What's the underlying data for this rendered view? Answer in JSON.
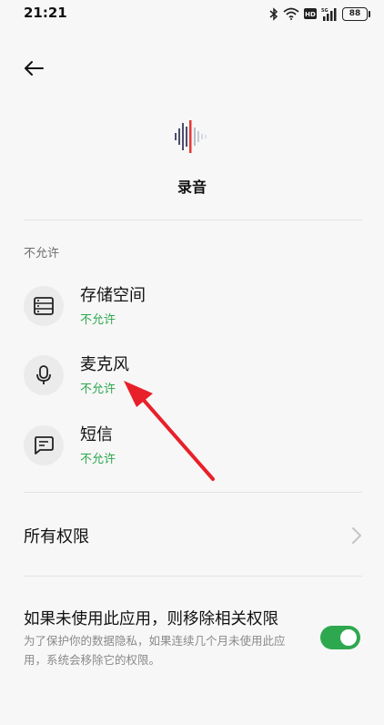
{
  "status_bar": {
    "time": "21:21",
    "battery_level": "88",
    "icons": [
      "bluetooth-icon",
      "wifi-icon",
      "hd-icon",
      "cellular-5g-icon",
      "battery-icon"
    ]
  },
  "header": {
    "back_icon": "back-arrow-icon"
  },
  "app": {
    "name": "录音",
    "icon": "voice-waveform-icon"
  },
  "section": {
    "title": "不允许"
  },
  "permissions": [
    {
      "label": "存储空间",
      "status": "不允许",
      "icon": "storage-icon"
    },
    {
      "label": "麦克风",
      "status": "不允许",
      "icon": "microphone-icon"
    },
    {
      "label": "短信",
      "status": "不允许",
      "icon": "message-icon"
    }
  ],
  "all_permissions": {
    "label": "所有权限",
    "icon": "chevron-right-icon"
  },
  "auto_remove": {
    "title": "如果未使用此应用，则移除相关权限",
    "description": "为了保护你的数据隐私，如果连续几个月未使用此应用，系统会移除它的权限。",
    "enabled": true
  },
  "colors": {
    "accent_green": "#2ea84e",
    "annotation_arrow": "#e8202a",
    "background": "#f7f7f7"
  }
}
